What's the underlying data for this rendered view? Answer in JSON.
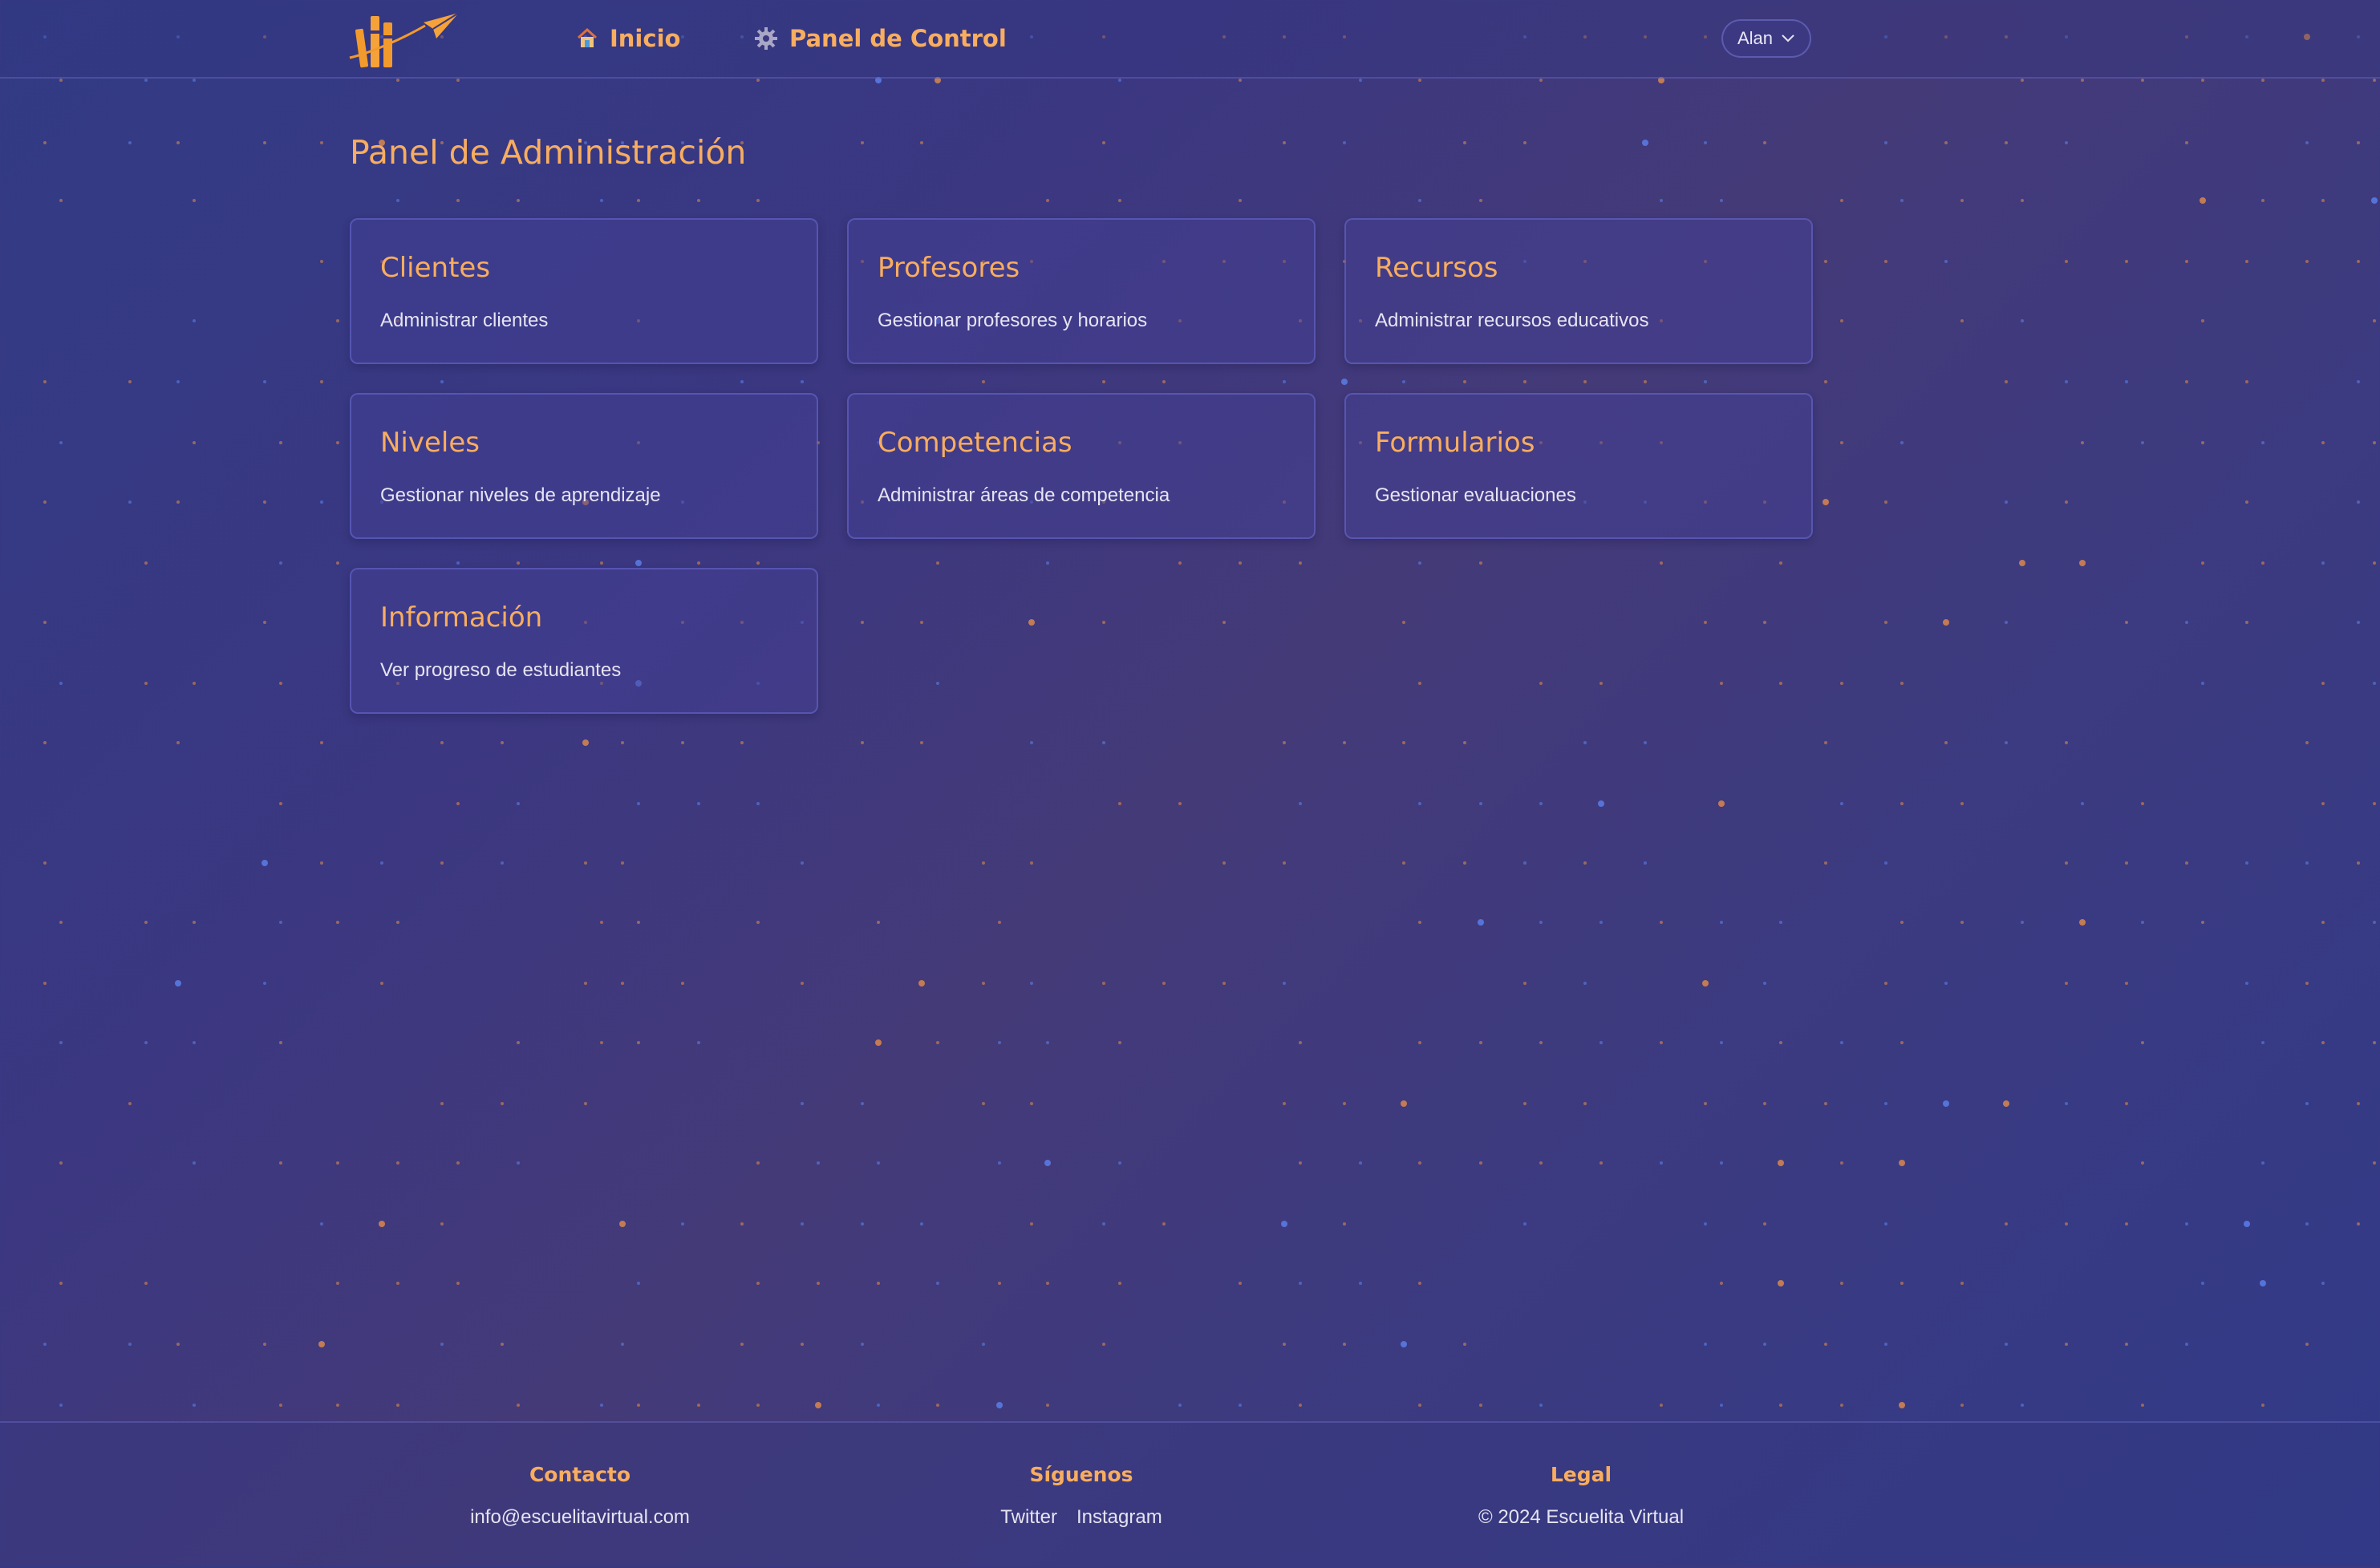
{
  "header": {
    "nav": [
      {
        "label": "Inicio",
        "icon": "home-icon"
      },
      {
        "label": "Panel de Control",
        "icon": "gear-icon"
      }
    ],
    "user": {
      "name": "Alan",
      "icon": "chevron-down-icon"
    }
  },
  "main": {
    "title": "Panel de Administración",
    "cards": [
      {
        "title": "Clientes",
        "description": "Administrar clientes"
      },
      {
        "title": "Profesores",
        "description": "Gestionar profesores y horarios"
      },
      {
        "title": "Recursos",
        "description": "Administrar recursos educativos"
      },
      {
        "title": "Niveles",
        "description": "Gestionar niveles de aprendizaje"
      },
      {
        "title": "Competencias",
        "description": "Administrar áreas de competencia"
      },
      {
        "title": "Formularios",
        "description": "Gestionar evaluaciones"
      },
      {
        "title": "Información",
        "description": "Ver progreso de estudiantes"
      }
    ]
  },
  "footer": {
    "contact": {
      "title": "Contacto",
      "email": "info@escuelitavirtual.com"
    },
    "social": {
      "title": "Síguenos",
      "links": [
        "Twitter",
        "Instagram"
      ]
    },
    "legal": {
      "title": "Legal",
      "text": "© 2024 Escuelita Virtual"
    }
  },
  "colors": {
    "accent": "#f8ad5f",
    "background": "#3b3781",
    "card_border": "#6e70d7",
    "text": "#e6e4f2"
  }
}
